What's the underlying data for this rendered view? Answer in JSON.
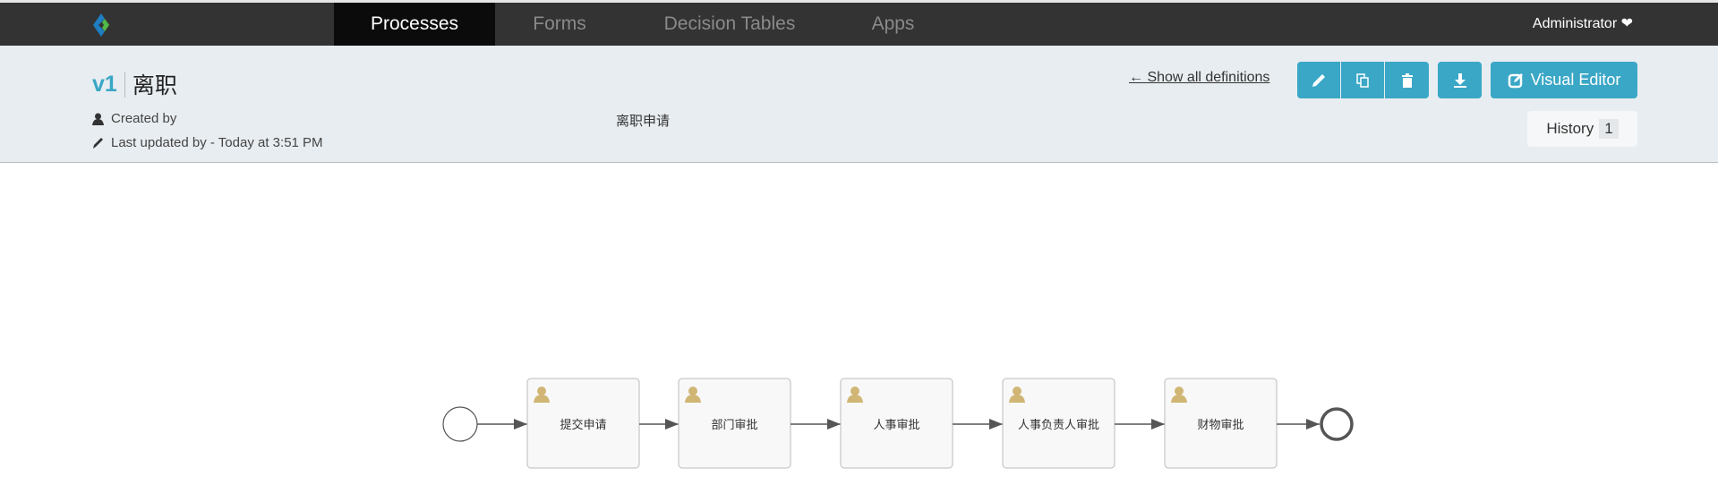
{
  "nav": {
    "tabs": [
      {
        "label": "Processes",
        "active": true
      },
      {
        "label": "Forms",
        "active": false
      },
      {
        "label": "Decision Tables",
        "active": false
      },
      {
        "label": "Apps",
        "active": false
      }
    ],
    "user": "Administrator"
  },
  "header": {
    "version": "v1",
    "name": "离职",
    "created_by": "Created by",
    "last_updated": "Last updated by - Today at 3:51 PM",
    "description": "离职申请",
    "show_all": "Show all definitions",
    "visual_editor": "Visual Editor",
    "history_label": "History",
    "history_count": "1"
  },
  "colors": {
    "accent": "#3aa7c6",
    "navbar": "#333333",
    "header_bg": "#e8edf1",
    "user_task_icon": "#d1b574"
  },
  "diagram": {
    "tasks": [
      "提交申请",
      "部门审批",
      "人事审批",
      "人事负责人审批",
      "财物审批"
    ]
  }
}
